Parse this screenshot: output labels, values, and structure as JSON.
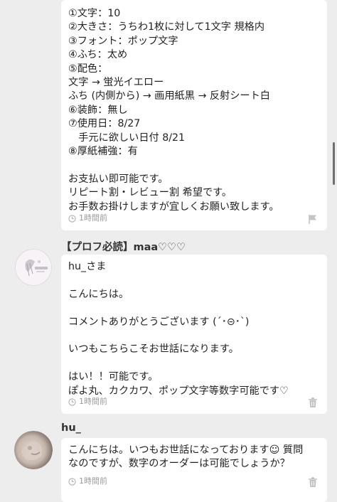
{
  "messages": [
    {
      "lines": [
        "①文字：10",
        "②大きさ：うちわ1枚に対して1文字 規格内",
        "③フォント：ポップ文字",
        "④ふち：太め",
        "⑤配色：",
        "文字 → 蛍光イエロー",
        "ふち (内側から) → 画用紙黒 → 反射シート白",
        "⑥装飾：無し",
        "⑦使用日：8/27",
        "　手元に欲しい日付 8/21",
        "⑧厚紙補強：有",
        "",
        "お支払い即可能です。",
        "リピート割・レビュー割 希望です。",
        "お手数お掛けしますが宜しくお願い致します。"
      ],
      "time": "1時間前",
      "action": "flag-icon"
    },
    {
      "username": "【プロフ必読】maa♡♡♡",
      "lines": [
        "hu_さま",
        "",
        "こんにちは。",
        "",
        "コメントありがとうございます (´･⊝･`)",
        "",
        "いつもこちらこそお世話になります。",
        "",
        "はい！！可能です。",
        "ぽよ丸、カクカワ、ポップ文字等数字可能です♡"
      ],
      "time": "1時間前",
      "action": "trash-icon"
    },
    {
      "username": "hu_",
      "lines": [
        "こんにちは。いつもお世話になっております☺ 質問",
        "なのですが、数字のオーダーは可能でしょうか？"
      ],
      "time": "1時間前",
      "action": "trash-icon"
    }
  ],
  "colors": {
    "background": "#ededed",
    "bubble": "#ffffff",
    "text": "#222222",
    "muted": "#9a9a9a"
  }
}
